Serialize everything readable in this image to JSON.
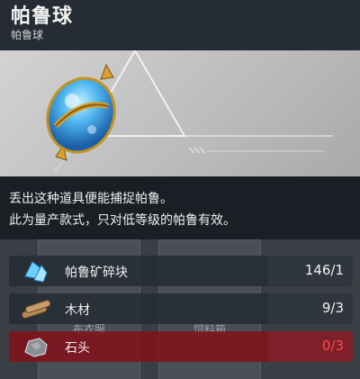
{
  "item": {
    "title": "帕鲁球",
    "subtitle": "帕鲁球",
    "icon": "pal-sphere-icon",
    "description": [
      "丢出这种道具便能捕捉帕鲁。",
      "此为量产款式，只对低等级的帕鲁有效。"
    ]
  },
  "background_cards": [
    {
      "label": "布衣服"
    },
    {
      "label": "饲料箱"
    }
  ],
  "materials": [
    {
      "name": "帕鲁矿碎块",
      "icon": "pal-fluid-shard-icon",
      "have": "146",
      "need": "1",
      "sufficient": true
    },
    {
      "name": "木材",
      "icon": "wood-icon",
      "have": "9",
      "need": "3",
      "sufficient": true
    },
    {
      "name": "石头",
      "icon": "stone-icon",
      "have": "0",
      "need": "3",
      "sufficient": false
    }
  ],
  "colors": {
    "insufficient": "#ff4b4b",
    "sphere_blue": "#4fb6f0",
    "sphere_gold": "#d9a12a"
  }
}
